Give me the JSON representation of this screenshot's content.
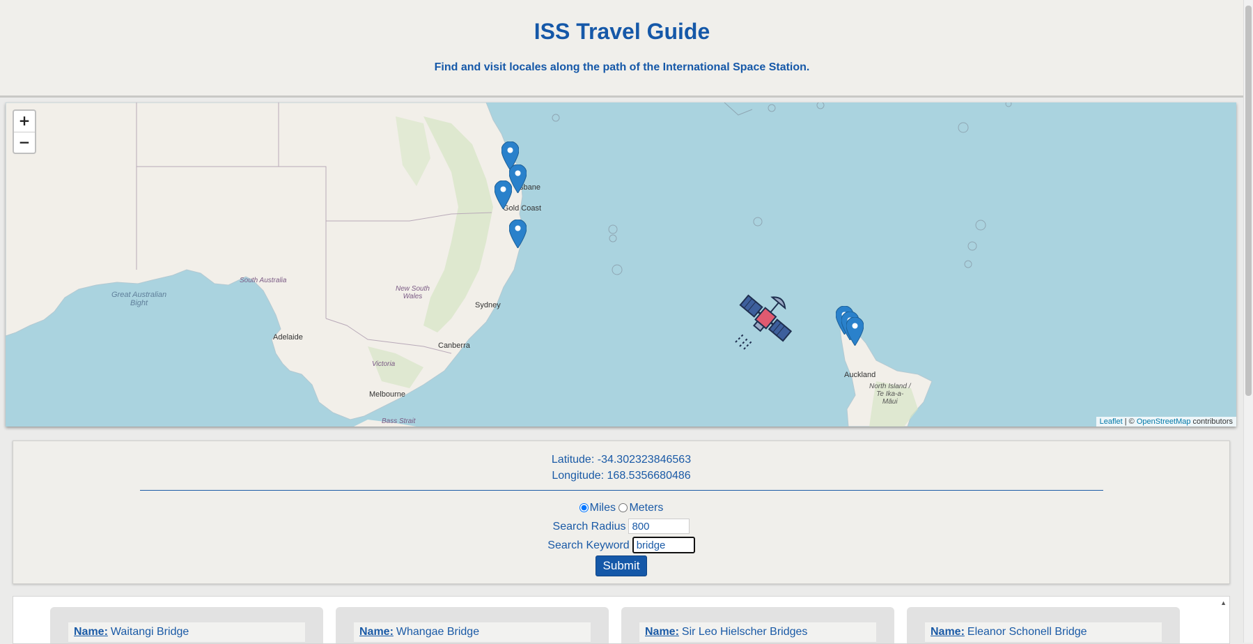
{
  "header": {
    "title": "ISS Travel Guide",
    "subtitle": "Find and visit locales along the path of the International Space Station."
  },
  "map": {
    "zoom_in": "+",
    "zoom_out": "−",
    "attribution": {
      "leaflet": "Leaflet",
      "sep": " | © ",
      "osm": "OpenStreetMap",
      "contributors": " contributors"
    },
    "labels": {
      "gold_coast": "Gold Coast",
      "sydney": "Sydney",
      "canberra": "Canberra",
      "melbourne": "Melbourne",
      "adelaide": "Adelaide",
      "auckland": "Auckland",
      "south_australia": "South Australia",
      "new_south_wales": "New South\nWales",
      "victoria": "Victoria",
      "great_australian_bight": "Great Australian\nBight",
      "bass_strait": "Bass Strait",
      "north_island": "North Island /\nTe Ika-a-\nMāui",
      "brisbane_partial": "sbane"
    },
    "markers": [
      {
        "name": "marker-qld-1"
      },
      {
        "name": "marker-qld-2"
      },
      {
        "name": "marker-qld-3"
      },
      {
        "name": "marker-nsw-1"
      },
      {
        "name": "marker-nz-1"
      },
      {
        "name": "marker-nz-2"
      },
      {
        "name": "marker-nz-3"
      }
    ],
    "iss_icon": "satellite-icon"
  },
  "info": {
    "latitude_label": "Latitude:",
    "latitude": "-34.302323846563",
    "longitude_label": "Longitude:",
    "longitude": "168.5356680486",
    "unit_miles": "Miles",
    "unit_meters": "Meters",
    "selected_unit": "Miles",
    "radius_label": "Search Radius",
    "radius_value": "800",
    "keyword_label": "Search Keyword",
    "keyword_value": "bridge",
    "submit_label": "Submit"
  },
  "results": {
    "name_label": "Name:",
    "cards": [
      {
        "name": "Waitangi Bridge"
      },
      {
        "name": "Whangae Bridge"
      },
      {
        "name": "Sir Leo Hielscher Bridges"
      },
      {
        "name": "Eleanor Schonell Bridge"
      }
    ]
  },
  "colors": {
    "brand_blue": "#1558a8",
    "water": "#aad3df",
    "land": "#f2efe9",
    "marker": "#2a81cb"
  }
}
